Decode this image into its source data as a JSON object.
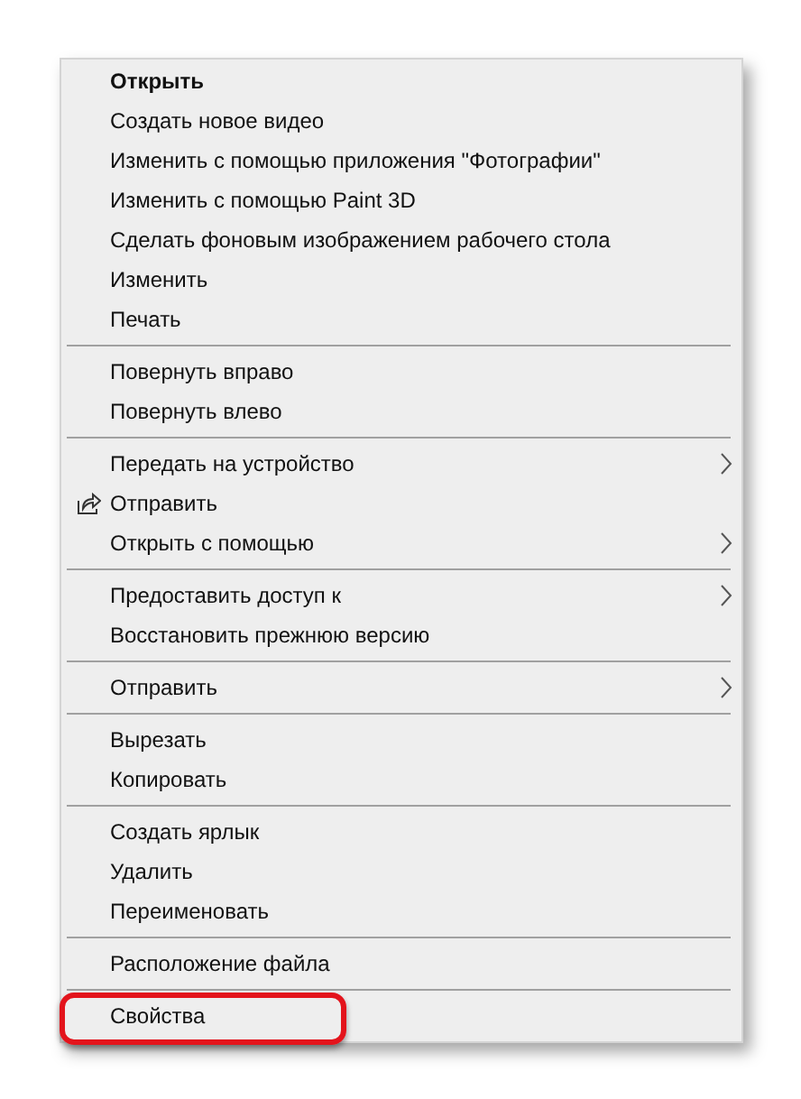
{
  "menu": {
    "groups": [
      [
        {
          "label": "Открыть",
          "default": true,
          "submenu": false,
          "kind": "plain",
          "circled": false
        },
        {
          "label": "Создать новое видео",
          "default": false,
          "submenu": false,
          "kind": "plain",
          "circled": false
        },
        {
          "label": "Изменить с помощью приложения \"Фотографии\"",
          "default": false,
          "submenu": false,
          "kind": "plain",
          "circled": false
        },
        {
          "label": "Изменить с помощью Paint 3D",
          "default": false,
          "submenu": false,
          "kind": "plain",
          "circled": false
        },
        {
          "label": "Сделать фоновым изображением рабочего стола",
          "default": false,
          "submenu": false,
          "kind": "plain",
          "circled": false
        },
        {
          "label": "Изменить",
          "default": false,
          "submenu": false,
          "kind": "plain",
          "circled": false
        },
        {
          "label": "Печать",
          "default": false,
          "submenu": false,
          "kind": "plain",
          "circled": false
        }
      ],
      [
        {
          "label": "Повернуть вправо",
          "default": false,
          "submenu": false,
          "kind": "plain",
          "circled": false
        },
        {
          "label": "Повернуть влево",
          "default": false,
          "submenu": false,
          "kind": "plain",
          "circled": false
        }
      ],
      [
        {
          "label": "Передать на устройство",
          "default": false,
          "submenu": true,
          "kind": "plain",
          "circled": false
        },
        {
          "label": "Отправить",
          "default": false,
          "submenu": false,
          "kind": "share",
          "circled": false
        },
        {
          "label": "Открыть с помощью",
          "default": false,
          "submenu": true,
          "kind": "plain",
          "circled": false
        }
      ],
      [
        {
          "label": "Предоставить доступ к",
          "default": false,
          "submenu": true,
          "kind": "plain",
          "circled": false
        },
        {
          "label": "Восстановить прежнюю версию",
          "default": false,
          "submenu": false,
          "kind": "plain",
          "circled": false
        }
      ],
      [
        {
          "label": "Отправить",
          "default": false,
          "submenu": true,
          "kind": "plain",
          "circled": false
        }
      ],
      [
        {
          "label": "Вырезать",
          "default": false,
          "submenu": false,
          "kind": "plain",
          "circled": false
        },
        {
          "label": "Копировать",
          "default": false,
          "submenu": false,
          "kind": "plain",
          "circled": false
        }
      ],
      [
        {
          "label": "Создать ярлык",
          "default": false,
          "submenu": false,
          "kind": "plain",
          "circled": false
        },
        {
          "label": "Удалить",
          "default": false,
          "submenu": false,
          "kind": "plain",
          "circled": false
        },
        {
          "label": "Переименовать",
          "default": false,
          "submenu": false,
          "kind": "plain",
          "circled": false
        }
      ],
      [
        {
          "label": "Расположение файла",
          "default": false,
          "submenu": false,
          "kind": "plain",
          "circled": false
        }
      ],
      [
        {
          "label": "Свойства",
          "default": false,
          "submenu": false,
          "kind": "plain",
          "circled": true
        }
      ]
    ]
  }
}
